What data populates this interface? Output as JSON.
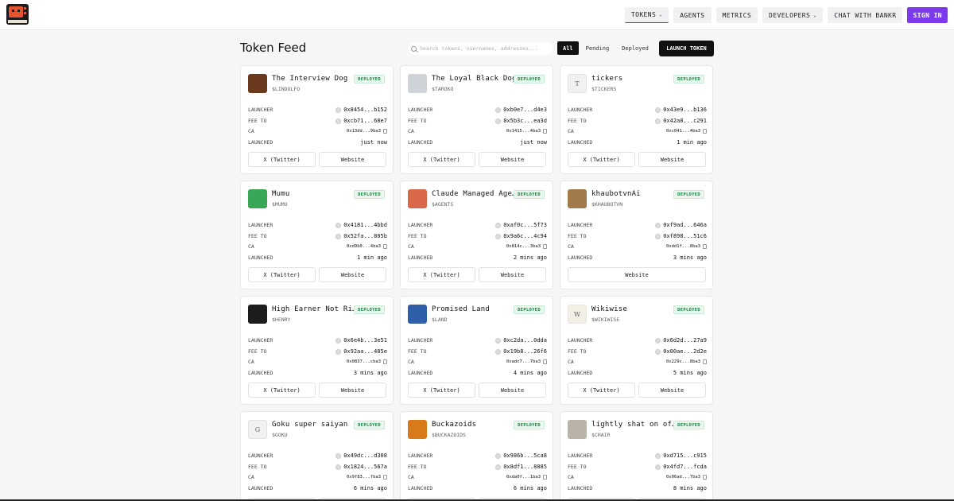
{
  "nav": {
    "items": [
      {
        "label": "TOKENS",
        "dropdown": true,
        "active": true
      },
      {
        "label": "AGENTS",
        "dropdown": false
      },
      {
        "label": "METRICS",
        "dropdown": false
      },
      {
        "label": "DEVELOPERS",
        "dropdown": true
      },
      {
        "label": "CHAT WITH BANKR",
        "dropdown": false
      }
    ],
    "sign_in": "SIGN IN"
  },
  "page_title": "Token Feed",
  "search": {
    "placeholder": "Search tokens, usernames, addresses..."
  },
  "filters": [
    "All",
    "Pending",
    "Deployed"
  ],
  "launch_label": "LAUNCH TOKEN",
  "row_labels": {
    "launcher": "LAUNCHER",
    "fee_to": "FEE TO",
    "ca": "CA",
    "launched": "LAUNCHED"
  },
  "link_labels": {
    "twitter": "X (Twitter)",
    "website": "Website"
  },
  "tokens": [
    {
      "name": "The Interview Dog",
      "ticker": "$LINDOLFO",
      "status": "DEPLOYED",
      "launcher": "0x8454...b152",
      "fee_to": "0xcb71...68e7",
      "ca": "0x13dd...9ba3",
      "launched": "just now",
      "avatar_color": "#6b3a1e",
      "initial": "",
      "links": [
        "twitter",
        "website"
      ]
    },
    {
      "name": "The Loyal Black Dog",
      "ticker": "$TAROKO",
      "status": "DEPLOYED",
      "launcher": "0xb0e7...d4e3",
      "fee_to": "0x5b3c...ea3d",
      "ca": "0x1415...4ba3",
      "launched": "just now",
      "avatar_color": "#cfd2d6",
      "initial": "",
      "links": [
        "twitter",
        "website"
      ]
    },
    {
      "name": "tickers",
      "ticker": "$TICKERS",
      "status": "DEPLOYED",
      "launcher": "0x43e9...b136",
      "fee_to": "0x42a8...c291",
      "ca": "0xc041...4ba3",
      "launched": "1 min ago",
      "avatar_color": "#f1f1f3",
      "initial": "T",
      "links": [
        "twitter",
        "website"
      ]
    },
    {
      "name": "Mumu",
      "ticker": "$MUMU",
      "status": "DEPLOYED",
      "launcher": "0x4181...4bbd",
      "fee_to": "0x52fa...805b",
      "ca": "0xd9b0...4ba3",
      "launched": "1 min ago",
      "avatar_color": "#3aa657",
      "initial": "",
      "links": [
        "twitter",
        "website"
      ]
    },
    {
      "name": "Claude Managed Agents",
      "ticker": "$AGENTS",
      "status": "DEPLOYED",
      "launcher": "0xaf0c...5f73",
      "fee_to": "0x9a6c...4c94",
      "ca": "0x814c...3ba3",
      "launched": "2 mins ago",
      "avatar_color": "#d9674a",
      "initial": "",
      "links": [
        "twitter",
        "website"
      ]
    },
    {
      "name": "khaubotvnAi",
      "ticker": "$KHAUBOTVN",
      "status": "DEPLOYED",
      "launcher": "0xf9ad...646a",
      "fee_to": "0xf898...51c6",
      "ca": "0xdd1f...8ba3",
      "launched": "3 mins ago",
      "avatar_color": "#a07a4a",
      "initial": "",
      "links": [
        "website"
      ]
    },
    {
      "name": "High Earner Not Rich",
      "ticker": "$HENRY",
      "status": "DEPLOYED",
      "launcher": "0x6e4b...3e51",
      "fee_to": "0x92aa...485e",
      "ca": "0x0837...cba3",
      "launched": "3 mins ago",
      "avatar_color": "#1c1c1c",
      "initial": "",
      "links": [
        "twitter",
        "website"
      ]
    },
    {
      "name": "Promised Land",
      "ticker": "$LAND",
      "status": "DEPLOYED",
      "launcher": "0xc2da...0dda",
      "fee_to": "0x19b8...26f6",
      "ca": "0xadc7...7ba3",
      "launched": "4 mins ago",
      "avatar_color": "#2f5fa8",
      "initial": "",
      "links": [
        "twitter",
        "website"
      ]
    },
    {
      "name": "Wikiwise",
      "ticker": "$WIKIWISE",
      "status": "DEPLOYED",
      "launcher": "0x6d2d...27a9",
      "fee_to": "0x00ae...2d2e",
      "ca": "0x229c...8ba3",
      "launched": "5 mins ago",
      "avatar_color": "#f4efe4",
      "initial": "W",
      "links": [
        "twitter",
        "website"
      ]
    },
    {
      "name": "Goku super saiyan",
      "ticker": "$GOKU",
      "status": "DEPLOYED",
      "launcher": "0x49dc...d308",
      "fee_to": "0x1824...567a",
      "ca": "0x9f83...fba3",
      "launched": "6 mins ago",
      "avatar_color": "#f1f1f3",
      "initial": "G",
      "links": [
        "twitter",
        "website"
      ]
    },
    {
      "name": "Buckazoids",
      "ticker": "$BUCKAZOIDS",
      "status": "DEPLOYED",
      "launcher": "0x986b...5ca8",
      "fee_to": "0x8df1...8885",
      "ca": "0xda0f...1ba3",
      "launched": "6 mins ago",
      "avatar_color": "#d97a1a",
      "initial": "",
      "links": [
        "twitter",
        "website"
      ]
    },
    {
      "name": "lightly shat on office chair",
      "ticker": "$CHAIR",
      "status": "DEPLOYED",
      "launcher": "0xd715...c915",
      "fee_to": "0x4fd7...fcda",
      "ca": "0x06ad...7ba3",
      "launched": "8 mins ago",
      "avatar_color": "#b9b3aa",
      "initial": "",
      "links": [
        "twitter",
        "website"
      ]
    }
  ]
}
